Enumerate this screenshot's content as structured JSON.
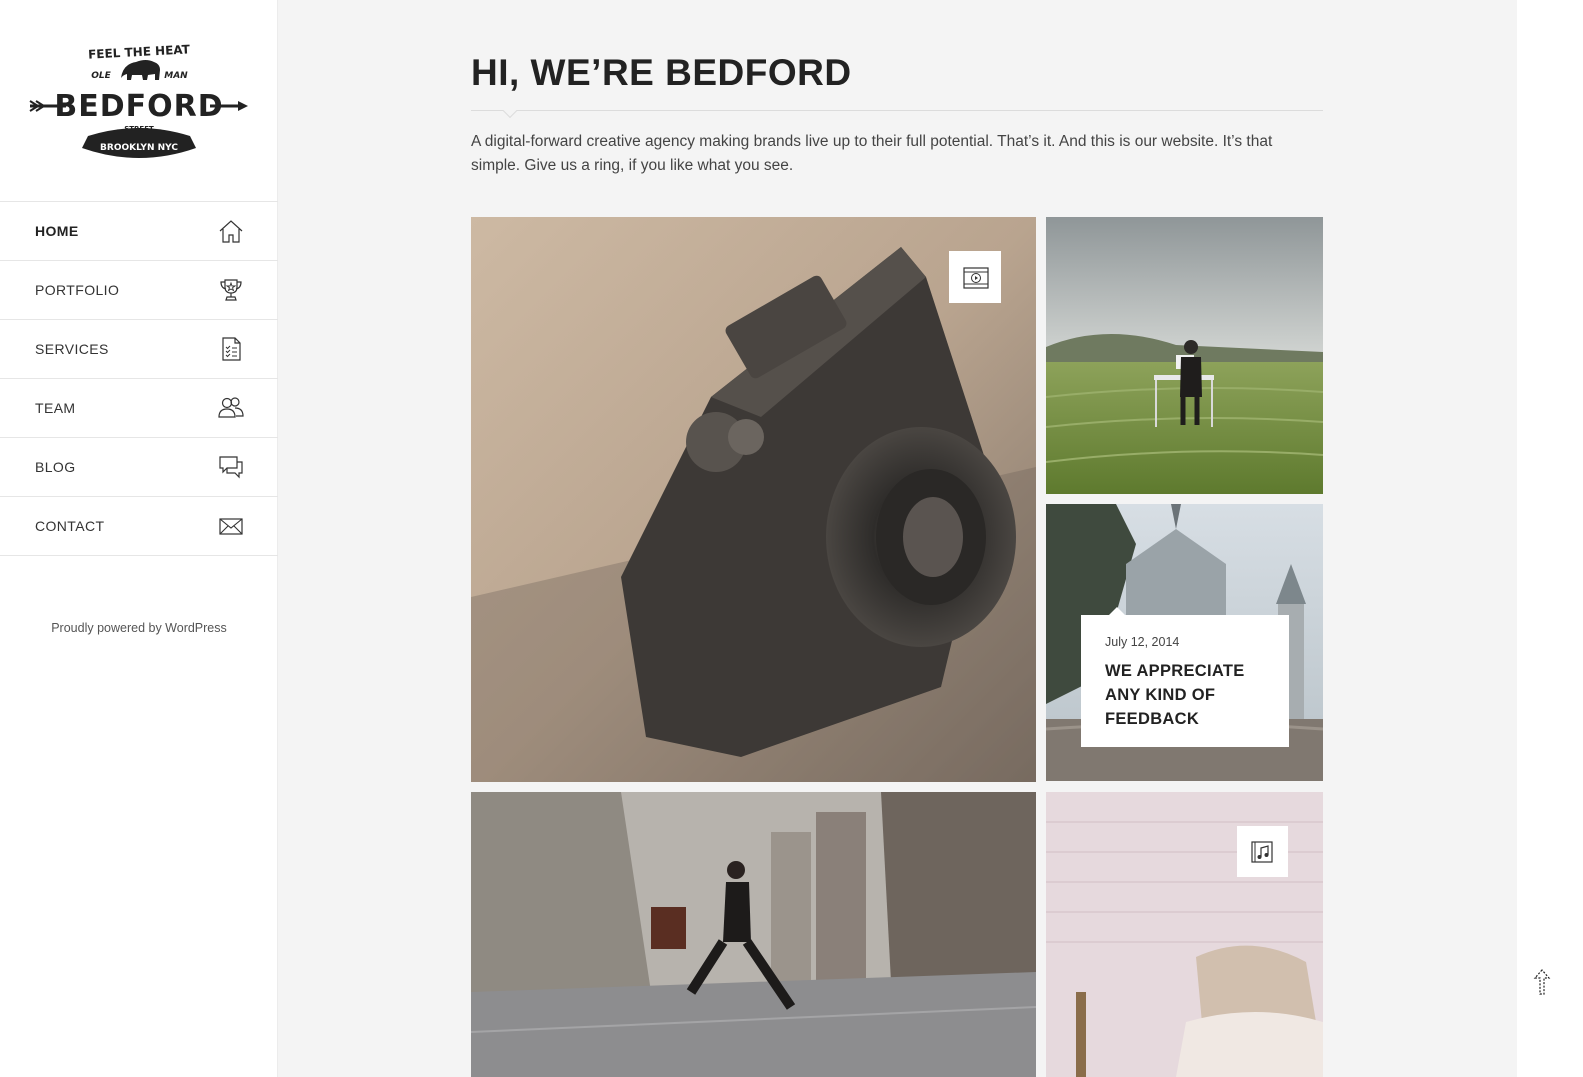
{
  "brand": {
    "logo_top": "FEEL THE HEAT",
    "logo_left": "OLE",
    "logo_right": "MAN",
    "logo_name": "BEDFORD",
    "logo_street": "STREET",
    "logo_city": "BROOKLYN NYC"
  },
  "sidebar": {
    "items": [
      {
        "label": "HOME",
        "icon": "home-icon"
      },
      {
        "label": "PORTFOLIO",
        "icon": "trophy-icon"
      },
      {
        "label": "SERVICES",
        "icon": "checklist-icon"
      },
      {
        "label": "TEAM",
        "icon": "users-icon"
      },
      {
        "label": "BLOG",
        "icon": "chat-icon"
      },
      {
        "label": "CONTACT",
        "icon": "envelope-icon"
      }
    ],
    "powered": "Proudly powered by WordPress"
  },
  "main": {
    "title": "HI, WE’RE BEDFORD",
    "intro": "A digital-forward creative agency making brands live up to their full potential. That’s it. And this is our website. It’s that simple. Give us a ring, if you like what you see."
  },
  "grid": {
    "tiles": [
      {
        "subject": "camera",
        "badge": "video-icon"
      },
      {
        "subject": "man at desk in field"
      },
      {
        "subject": "castle",
        "post": {
          "date": "July 12, 2014",
          "title": "WE APPRECIATE ANY KIND OF FEEDBACK"
        }
      },
      {
        "subject": "man jumping in street"
      },
      {
        "subject": "brick wall with pillows",
        "badge": "audio-icon"
      }
    ]
  },
  "colors": {
    "accent": "#222222",
    "main_bg": "#f4f4f4",
    "sidebar_bg": "#ffffff"
  }
}
